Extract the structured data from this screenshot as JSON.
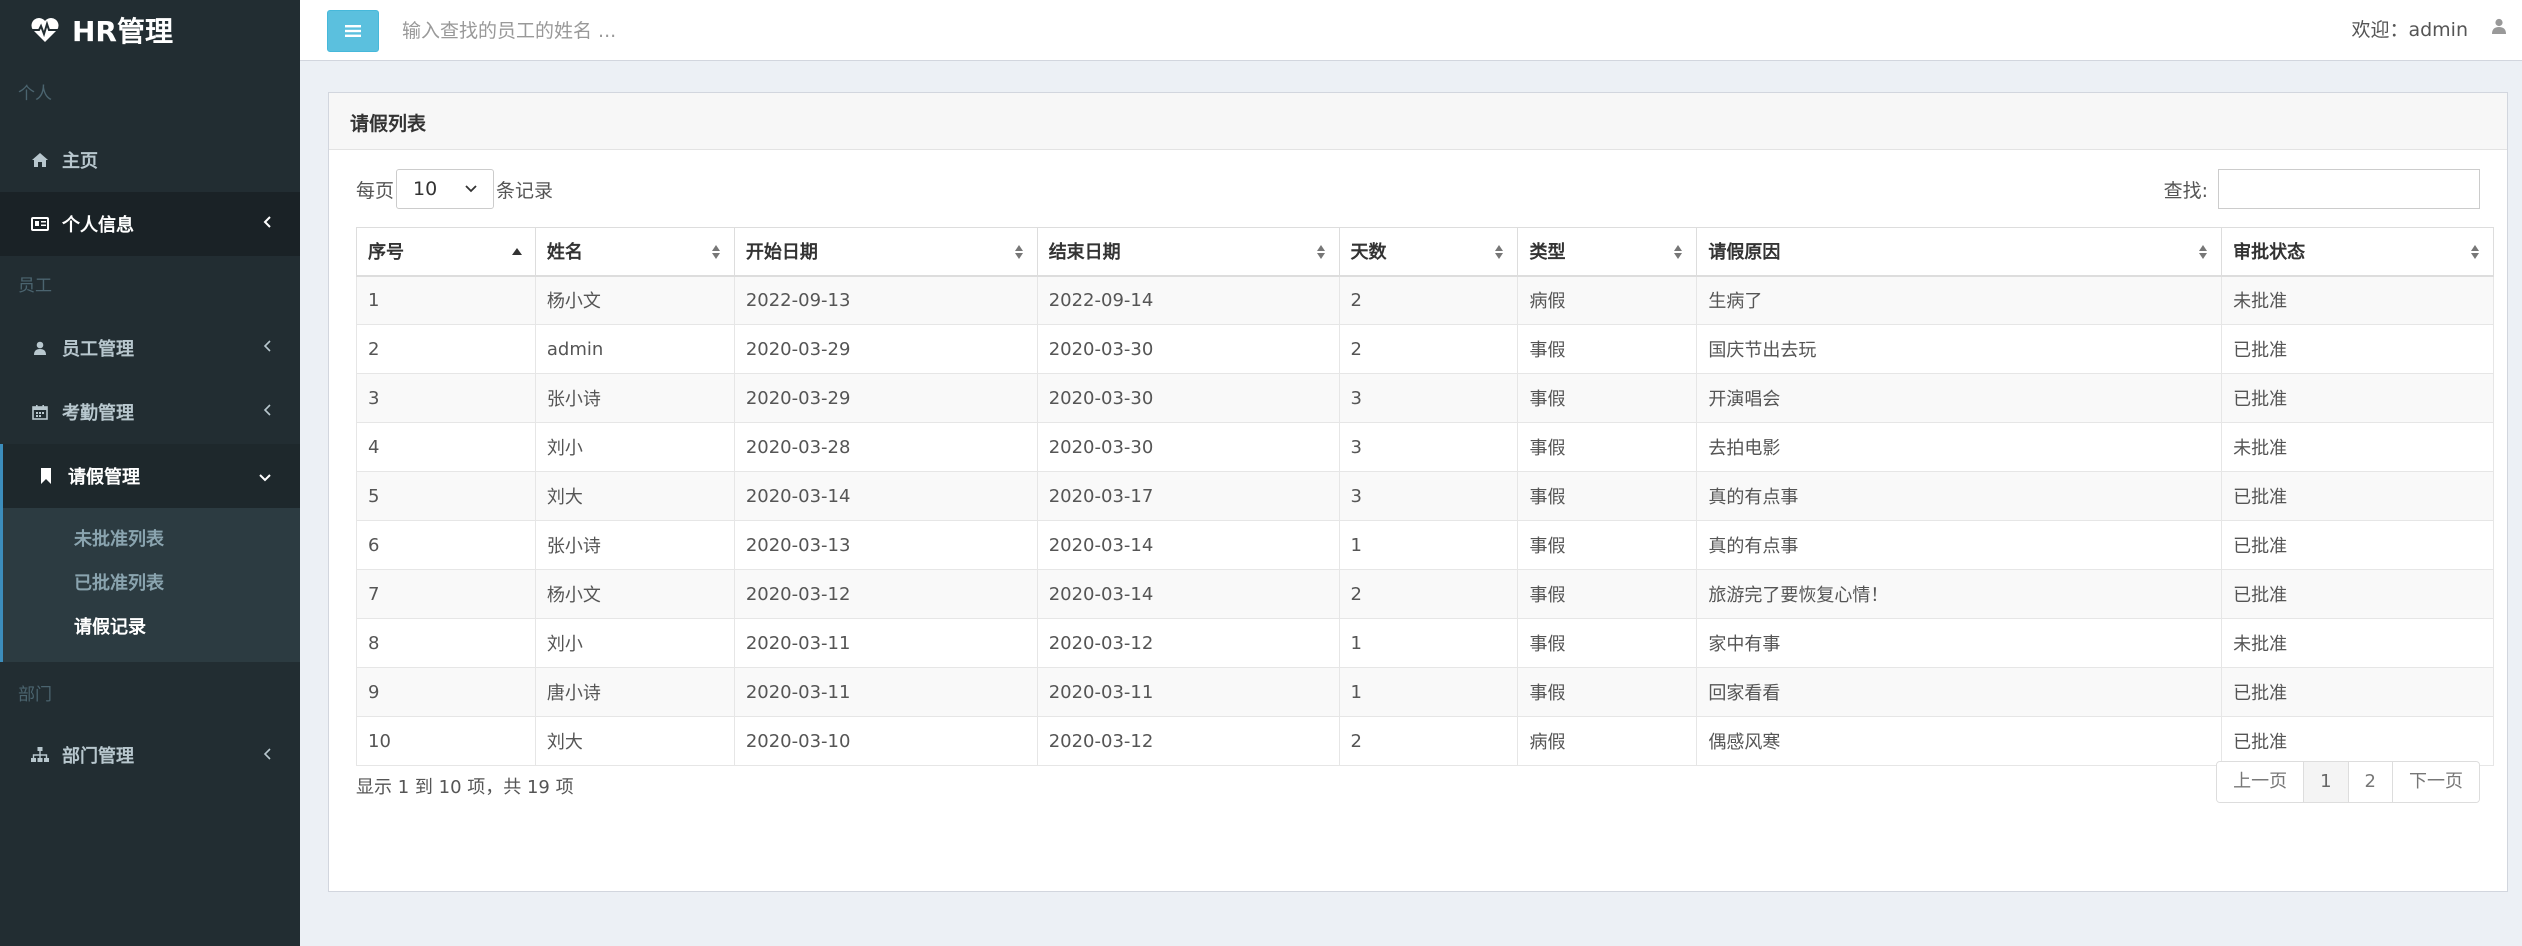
{
  "app": {
    "title": "HR管理"
  },
  "sidebar": {
    "sections": {
      "personal": "个人",
      "employee": "员工",
      "department": "部门"
    },
    "items": {
      "home": "主页",
      "personal_info": "个人信息",
      "employee_mgmt": "员工管理",
      "attendance_mgmt": "考勤管理",
      "leave_mgmt": "请假管理",
      "dept_mgmt": "部门管理"
    },
    "leave_sub": {
      "unapproved": "未批准列表",
      "approved": "已批准列表",
      "records": "请假记录"
    }
  },
  "header": {
    "search_placeholder": "输入查找的员工的姓名 ...",
    "welcome": "欢迎：admin"
  },
  "box": {
    "title": "请假列表",
    "length_prefix": "每页",
    "length_value": "10",
    "length_suffix": "条记录",
    "filter_label": "查找:"
  },
  "table": {
    "columns": [
      "序号",
      "姓名",
      "开始日期",
      "结束日期",
      "天数",
      "类型",
      "请假原因",
      "审批状态"
    ],
    "rows": [
      [
        "1",
        "杨小文",
        "2022-09-13",
        "2022-09-14",
        "2",
        "病假",
        "生病了",
        "未批准"
      ],
      [
        "2",
        "admin",
        "2020-03-29",
        "2020-03-30",
        "2",
        "事假",
        "国庆节出去玩",
        "已批准"
      ],
      [
        "3",
        "张小诗",
        "2020-03-29",
        "2020-03-30",
        "3",
        "事假",
        "开演唱会",
        "已批准"
      ],
      [
        "4",
        "刘小",
        "2020-03-28",
        "2020-03-30",
        "3",
        "事假",
        "去拍电影",
        "未批准"
      ],
      [
        "5",
        "刘大",
        "2020-03-14",
        "2020-03-17",
        "3",
        "事假",
        "真的有点事",
        "已批准"
      ],
      [
        "6",
        "张小诗",
        "2020-03-13",
        "2020-03-14",
        "1",
        "事假",
        "真的有点事",
        "已批准"
      ],
      [
        "7",
        "杨小文",
        "2020-03-12",
        "2020-03-14",
        "2",
        "事假",
        "旅游完了要恢复心情！",
        "已批准"
      ],
      [
        "8",
        "刘小",
        "2020-03-11",
        "2020-03-12",
        "1",
        "事假",
        "家中有事",
        "未批准"
      ],
      [
        "9",
        "唐小诗",
        "2020-03-11",
        "2020-03-11",
        "1",
        "事假",
        "回家看看",
        "已批准"
      ],
      [
        "10",
        "刘大",
        "2020-03-10",
        "2020-03-12",
        "2",
        "病假",
        "偶感风寒",
        "已批准"
      ]
    ]
  },
  "footer": {
    "info": "显示 1 到 10 项，共 19 项",
    "prev": "上一页",
    "page1": "1",
    "page2": "2",
    "next": "下一页"
  }
}
